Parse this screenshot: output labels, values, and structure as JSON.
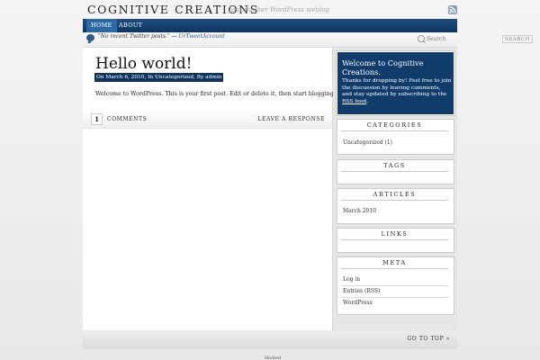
{
  "site": {
    "title": "COGNITIVE CREATIONS",
    "tagline": "Just another WordPress weblog"
  },
  "nav": {
    "items": [
      {
        "label": "HOME"
      },
      {
        "label": "ABOUT"
      }
    ]
  },
  "twitter": {
    "text": "\"No recent Twitter posts.\" — ",
    "account": "UrTweetAccount"
  },
  "search": {
    "placeholder": "Search",
    "button_label": "SEARCH"
  },
  "post": {
    "title": "Hello world!",
    "meta": "On March 6, 2010, In Uncategorized, By admin",
    "body": "Welcome to WordPress. This is your first post. Edit or delete it, then start blogging!",
    "comment_count": "1",
    "comments_label": "Comments",
    "leave_response": "Leave A Response"
  },
  "sidebar": {
    "welcome_title": "Welcome to Cognitive Creations.",
    "welcome_text": "Thanks for dropping by! Feel free to join the discussion by leaving comments, and stay updated by subscribing to the ",
    "welcome_rss_link": "RSS feed",
    "welcome_text_end": ".",
    "categories_title": "CATEGORIES",
    "categories_item": "Uncategorized (1)",
    "tags_title": "TAGS",
    "articles_title": "ARTICLES",
    "articles_item": "March 2010",
    "links_title": "LINKS",
    "meta_title": "META",
    "meta_items": [
      "Log in",
      "Entries (RSS)",
      "WordPress"
    ]
  },
  "footer": {
    "goto_top": "Go To Top »",
    "credit": "Hosted"
  },
  "colors": {
    "nav_blue": "#0d355f",
    "welcome_blue": "#0f3c6b"
  }
}
